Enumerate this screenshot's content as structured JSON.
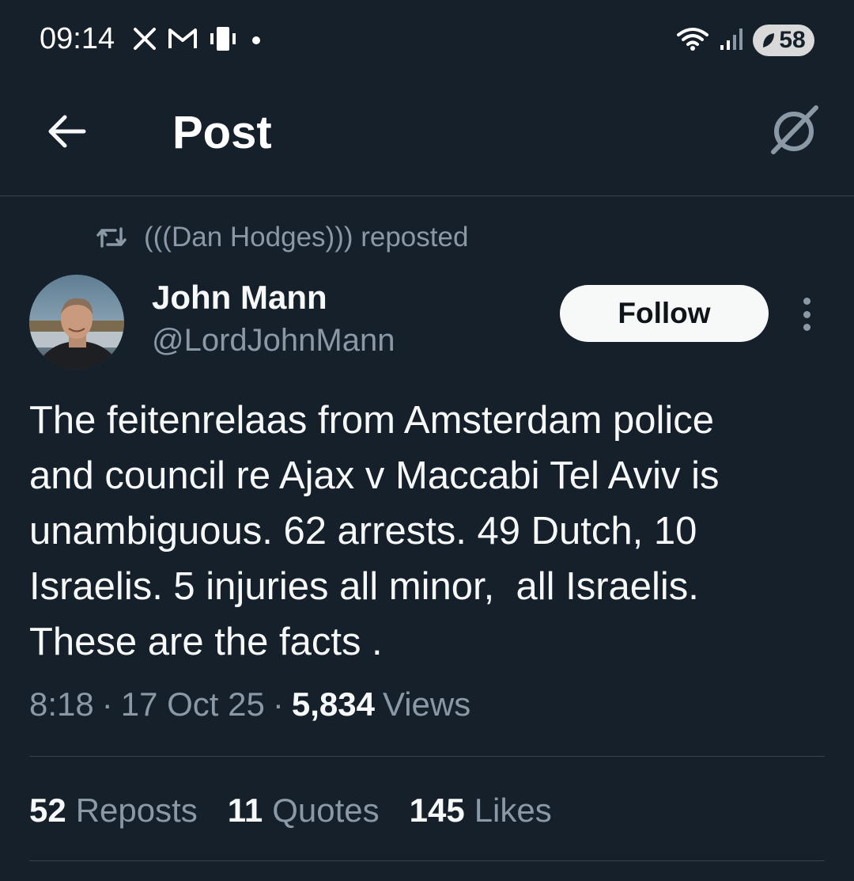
{
  "status_bar": {
    "time": "09:14",
    "left_icons": [
      "x-logo-icon",
      "gmail-icon",
      "vibrate-icon",
      "dot-icon"
    ],
    "right_icons": [
      "wifi-icon",
      "signal-icon"
    ],
    "battery_level": "58"
  },
  "header": {
    "title": "Post",
    "back_icon": "arrow-left-icon",
    "grok_icon": "grok-icon"
  },
  "repost": {
    "text": "(((Dan Hodges))) reposted",
    "icon": "repost-icon"
  },
  "author": {
    "name": "John Mann",
    "handle": "@LordJohnMann",
    "follow_label": "Follow",
    "more_icon": "more-vertical-icon"
  },
  "tweet": {
    "text": "The feitenrelaas from Amsterdam police\nand council re Ajax v Maccabi Tel Aviv is\nunambiguous. 62 arrests. 49 Dutch, 10\nIsraelis. 5 injuries all minor,  all Israelis.\nThese are the facts .",
    "time": "8:18",
    "date": "17 Oct 25",
    "separator": "·",
    "views_count": "5,834",
    "views_label": "Views"
  },
  "stats": {
    "reposts_count": "52",
    "reposts_label": "Reposts",
    "quotes_count": "11",
    "quotes_label": "Quotes",
    "likes_count": "145",
    "likes_label": "Likes"
  },
  "colors": {
    "background": "#15202b",
    "text_primary": "#f7f9f9",
    "text_secondary": "#8b98a5",
    "divider": "#38444d"
  }
}
